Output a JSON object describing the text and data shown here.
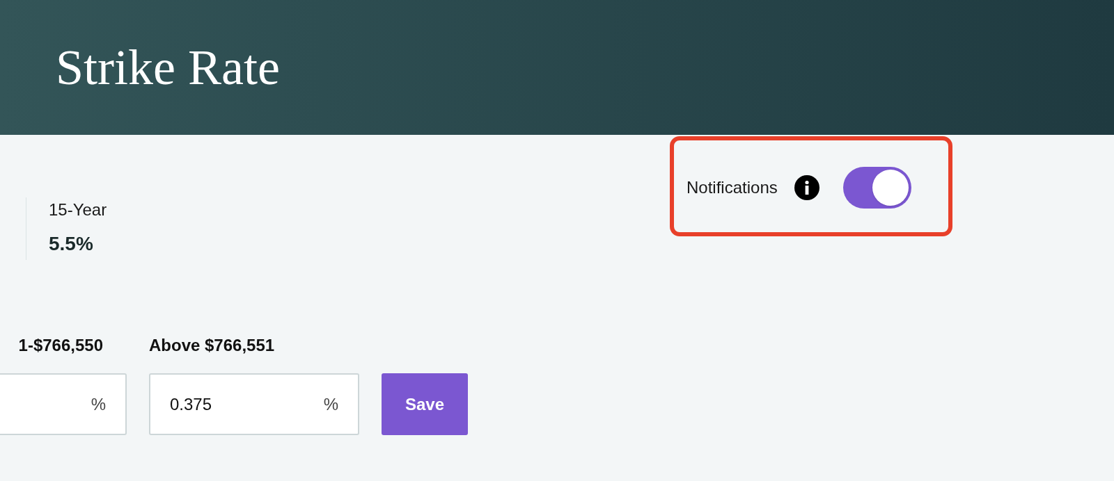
{
  "header": {
    "title": "Strike Rate"
  },
  "notifications": {
    "label": "Notifications",
    "on": true,
    "highlighted": true
  },
  "rates": [
    {
      "term": "15-Year",
      "value": "5.5%"
    }
  ],
  "tiers": [
    {
      "label": "1-$766,550",
      "unit": "%"
    },
    {
      "label": "Above $766,551",
      "value": "0.375",
      "unit": "%"
    }
  ],
  "save_button": "Save"
}
